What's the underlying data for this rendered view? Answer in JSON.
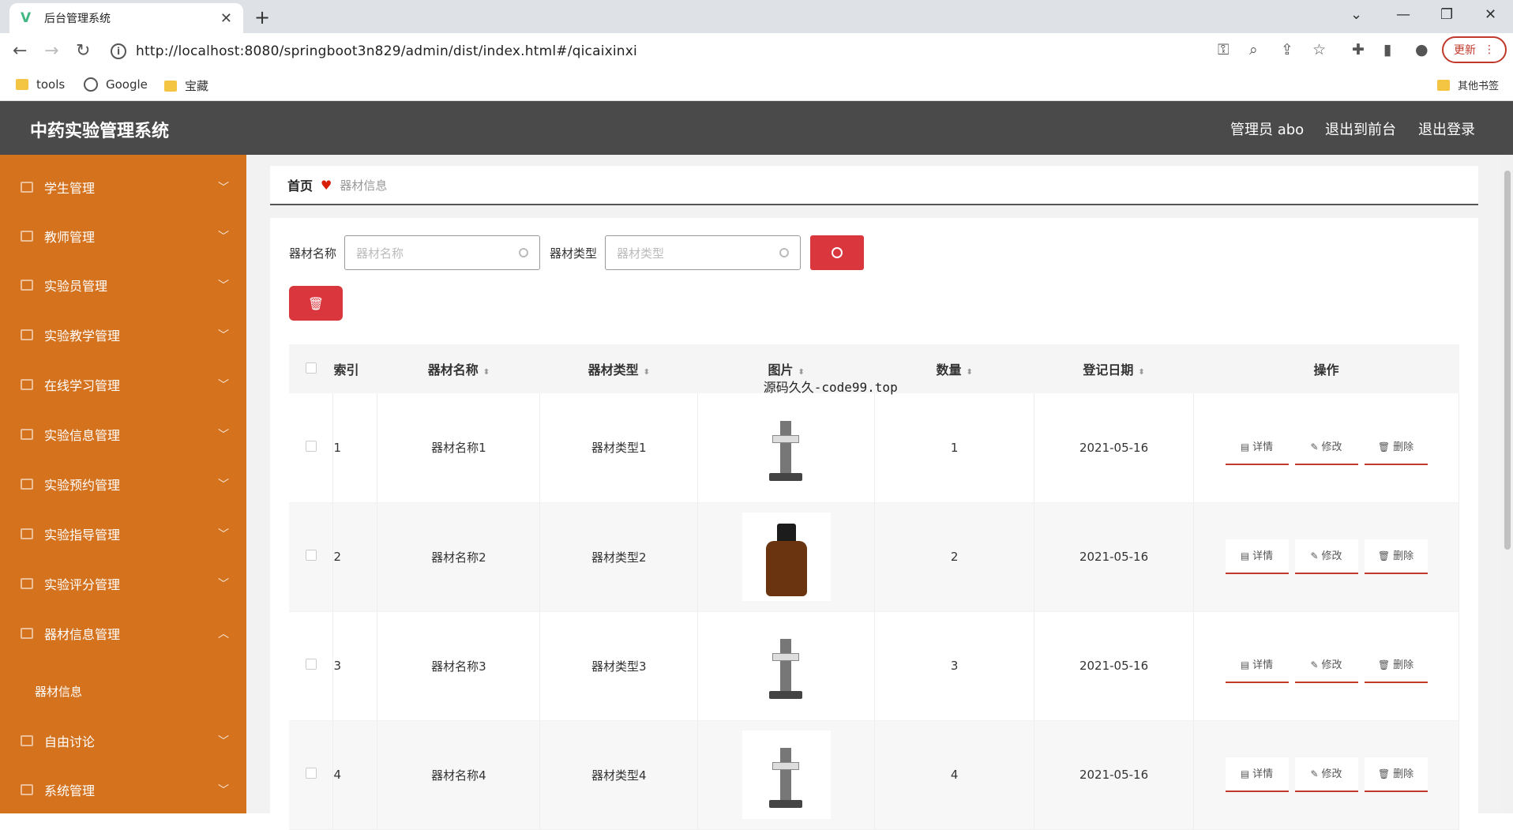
{
  "browser": {
    "tab_title": "后台管理系统",
    "tab_favicon": "V",
    "url": "http://localhost:8080/springboot3n829/admin/dist/index.html#/qicaixinxi",
    "update_label": "更新",
    "bookmarks": [
      {
        "label": "tools",
        "icon": "folder-icon"
      },
      {
        "label": "Google",
        "icon": "globe-icon"
      },
      {
        "label": "宝藏",
        "icon": "folder-icon"
      }
    ],
    "other_bookmarks": "其他书签"
  },
  "header": {
    "title": "中药实验管理系统",
    "user": "管理员 abo",
    "to_front": "退出到前台",
    "logout": "退出登录"
  },
  "sidebar": {
    "items": [
      {
        "label": "学生管理",
        "expanded": false
      },
      {
        "label": "教师管理",
        "expanded": false
      },
      {
        "label": "实验员管理",
        "expanded": false
      },
      {
        "label": "实验教学管理",
        "expanded": false
      },
      {
        "label": "在线学习管理",
        "expanded": false
      },
      {
        "label": "实验信息管理",
        "expanded": false
      },
      {
        "label": "实验预约管理",
        "expanded": false
      },
      {
        "label": "实验指导管理",
        "expanded": false
      },
      {
        "label": "实验评分管理",
        "expanded": false
      },
      {
        "label": "器材信息管理",
        "expanded": true
      },
      {
        "label": "自由讨论",
        "expanded": false
      },
      {
        "label": "系统管理",
        "expanded": false
      }
    ],
    "sub_item": "器材信息"
  },
  "breadcrumb": {
    "home": "首页",
    "current": "器材信息"
  },
  "search": {
    "name_label": "器材名称",
    "name_placeholder": "器材名称",
    "type_label": "器材类型",
    "type_placeholder": "器材类型"
  },
  "table": {
    "columns": [
      "索引",
      "器材名称",
      "器材类型",
      "图片",
      "数量",
      "登记日期",
      "操作"
    ],
    "rows": [
      {
        "index": "1",
        "name": "器材名称1",
        "type": "器材类型1",
        "image": "stand",
        "qty": "1",
        "date": "2021-05-16"
      },
      {
        "index": "2",
        "name": "器材名称2",
        "type": "器材类型2",
        "image": "bottle",
        "qty": "2",
        "date": "2021-05-16"
      },
      {
        "index": "3",
        "name": "器材名称3",
        "type": "器材类型3",
        "image": "stand",
        "qty": "3",
        "date": "2021-05-16"
      },
      {
        "index": "4",
        "name": "器材名称4",
        "type": "器材类型4",
        "image": "stand",
        "qty": "4",
        "date": "2021-05-16"
      }
    ],
    "actions": {
      "detail": "详情",
      "edit": "修改",
      "delete": "删除"
    },
    "overlay_text": "源码久久-code99.top"
  },
  "colors": {
    "sidebar": "#d4721e",
    "header": "#4a4a4a",
    "danger": "#d9363e"
  }
}
